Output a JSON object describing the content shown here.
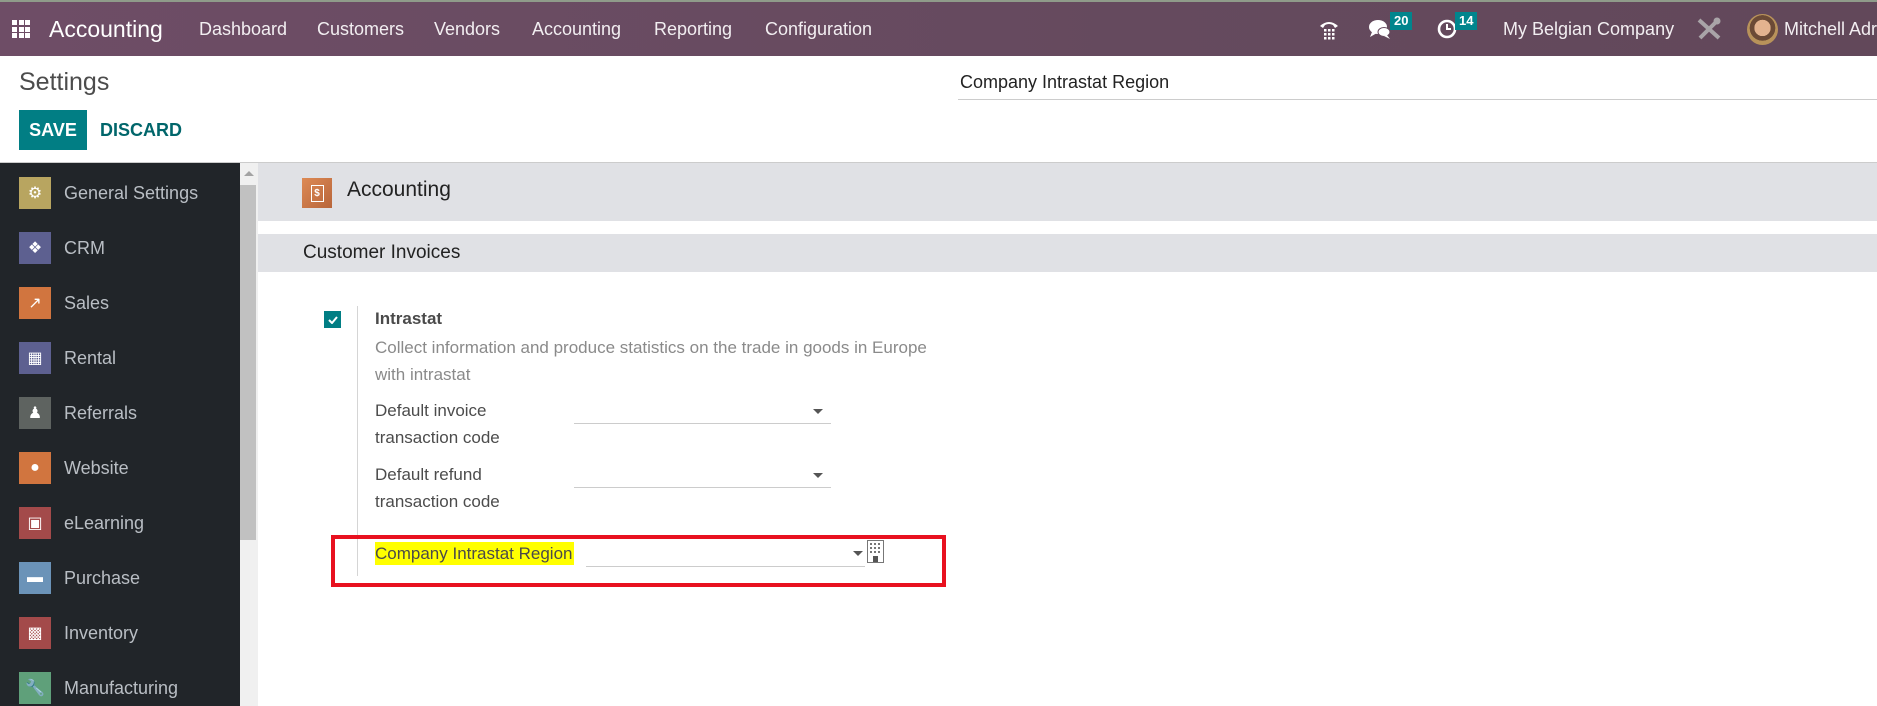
{
  "navbar": {
    "app_name": "Accounting",
    "menu": [
      "Dashboard",
      "Customers",
      "Vendors",
      "Accounting",
      "Reporting",
      "Configuration"
    ],
    "messages_count": "20",
    "activities_count": "14",
    "company": "My Belgian Company",
    "user": "Mitchell Admin",
    "user_visible": "Mitchell Adr",
    "bg_color": "#6e4d66",
    "badge_color": "#01858d"
  },
  "control_panel": {
    "title": "Settings",
    "save_label": "SAVE",
    "discard_label": "DISCARD",
    "search_value": "Company Intrastat Region"
  },
  "sidebar": {
    "items": [
      {
        "label": "General Settings",
        "icon": "gear-icon",
        "color": "#b8a560"
      },
      {
        "label": "CRM",
        "icon": "handshake-icon",
        "color": "#5d6090"
      },
      {
        "label": "Sales",
        "icon": "chart-up-icon",
        "color": "#d1753f"
      },
      {
        "label": "Rental",
        "icon": "calendar-grid-icon",
        "color": "#5d6090"
      },
      {
        "label": "Referrals",
        "icon": "person-icon",
        "color": "#5e6360"
      },
      {
        "label": "Website",
        "icon": "globe-icon",
        "color": "#d1753f"
      },
      {
        "label": "eLearning",
        "icon": "presentation-icon",
        "color": "#a34a4a"
      },
      {
        "label": "Purchase",
        "icon": "credit-card-icon",
        "color": "#6b93b8"
      },
      {
        "label": "Inventory",
        "icon": "box-icon",
        "color": "#a34a4a"
      },
      {
        "label": "Manufacturing",
        "icon": "wrench-icon",
        "color": "#5fa07a"
      }
    ]
  },
  "main": {
    "app_title": "Accounting",
    "section_title": "Customer Invoices",
    "setting": {
      "enabled": true,
      "title": "Intrastat",
      "description": "Collect information and produce statistics on the trade in goods in Europe with intrastat",
      "fields": [
        {
          "label": "Default invoice transaction code",
          "value": ""
        },
        {
          "label": "Default refund transaction code",
          "value": ""
        }
      ],
      "region_label": "Company Intrastat Region",
      "region_value": ""
    },
    "highlight_color": "#ffff00",
    "annotation_color": "#e8111f"
  }
}
